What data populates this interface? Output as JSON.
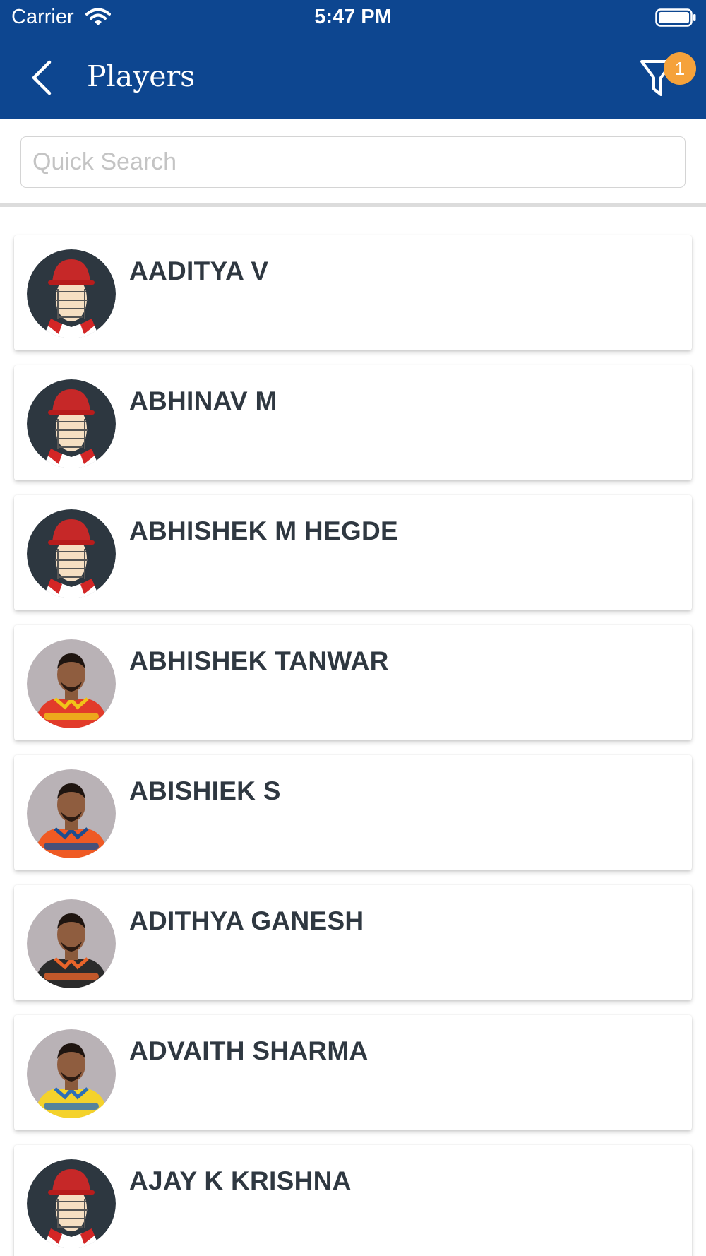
{
  "status_bar": {
    "carrier": "Carrier",
    "time": "5:47 PM"
  },
  "nav": {
    "title": "Players",
    "filter_badge": "1"
  },
  "search": {
    "placeholder": "Quick Search",
    "value": ""
  },
  "players": [
    {
      "name": "AADITYA V",
      "avatar": "placeholder-avatar"
    },
    {
      "name": "ABHINAV M",
      "avatar": "placeholder-avatar"
    },
    {
      "name": "ABHISHEK M HEGDE",
      "avatar": "placeholder-avatar"
    },
    {
      "name": "ABHISHEK TANWAR",
      "avatar": "photo-red-jersey"
    },
    {
      "name": "ABISHIEK S",
      "avatar": "photo-orange-jersey"
    },
    {
      "name": "ADITHYA GANESH",
      "avatar": "photo-black-orange-jersey"
    },
    {
      "name": "ADVAITH SHARMA",
      "avatar": "photo-yellow-jersey"
    },
    {
      "name": "AJAY K KRISHNA",
      "avatar": "placeholder-avatar"
    }
  ],
  "colors": {
    "header": "#0d4690",
    "badge": "#f5a23b",
    "name_text": "#2f3841"
  }
}
